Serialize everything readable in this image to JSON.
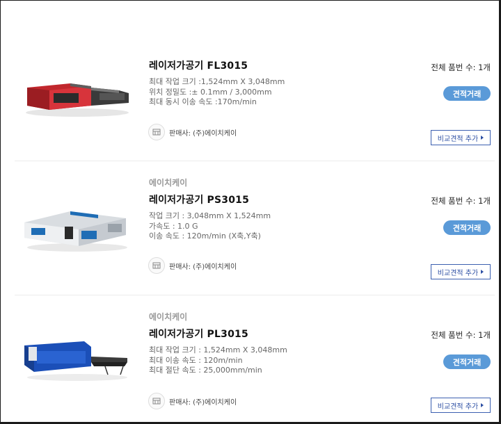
{
  "products": [
    {
      "maker": "",
      "title": "레이저가공기 FL3015",
      "specs": [
        "최대 작업 크기 :1,524mm X 3,048mm",
        "위치 정밀도 :± 0.1mm / 3,000mm",
        "최대 동시 이송 속도 :170m/min"
      ],
      "seller": "판매사: (주)에이치케이",
      "count": "전체 품번 수: 1개",
      "quote_label": "견적거래",
      "compare_label": "비교견적 추가",
      "image_icon": "laser-cutter-red-image"
    },
    {
      "maker": "에이치케이",
      "title": "레이저가공기 PS3015",
      "specs": [
        "작업 크기 : 3,048mm X 1,524mm",
        "가속도 : 1.0 G",
        "이송 속도 : 120m/min (X축,Y축)"
      ],
      "seller": "판매사: (주)에이치케이",
      "count": "전체 품번 수: 1개",
      "quote_label": "견적거래",
      "compare_label": "비교견적 추가",
      "image_icon": "laser-cutter-white-image"
    },
    {
      "maker": "에이치케이",
      "title": "레이저가공기 PL3015",
      "specs": [
        "최대 작업 크기 : 1,524mm X 3,048mm",
        "최대 이송 속도 : 120m/min",
        "최대 절단 속도 : 25,000mm/min"
      ],
      "seller": "판매사: (주)에이치케이",
      "count": "전체 품번 수: 1개",
      "quote_label": "견적거래",
      "compare_label": "비교견적 추가",
      "image_icon": "laser-cutter-blue-image"
    }
  ],
  "colors": {
    "accent": "#5a9ad8",
    "compare_border": "#3b5fb0",
    "muted_text": "#666666",
    "maker_text": "#999999"
  },
  "icons": {
    "seller": "store-icon",
    "compare_arrow": "triangle-right-icon"
  }
}
